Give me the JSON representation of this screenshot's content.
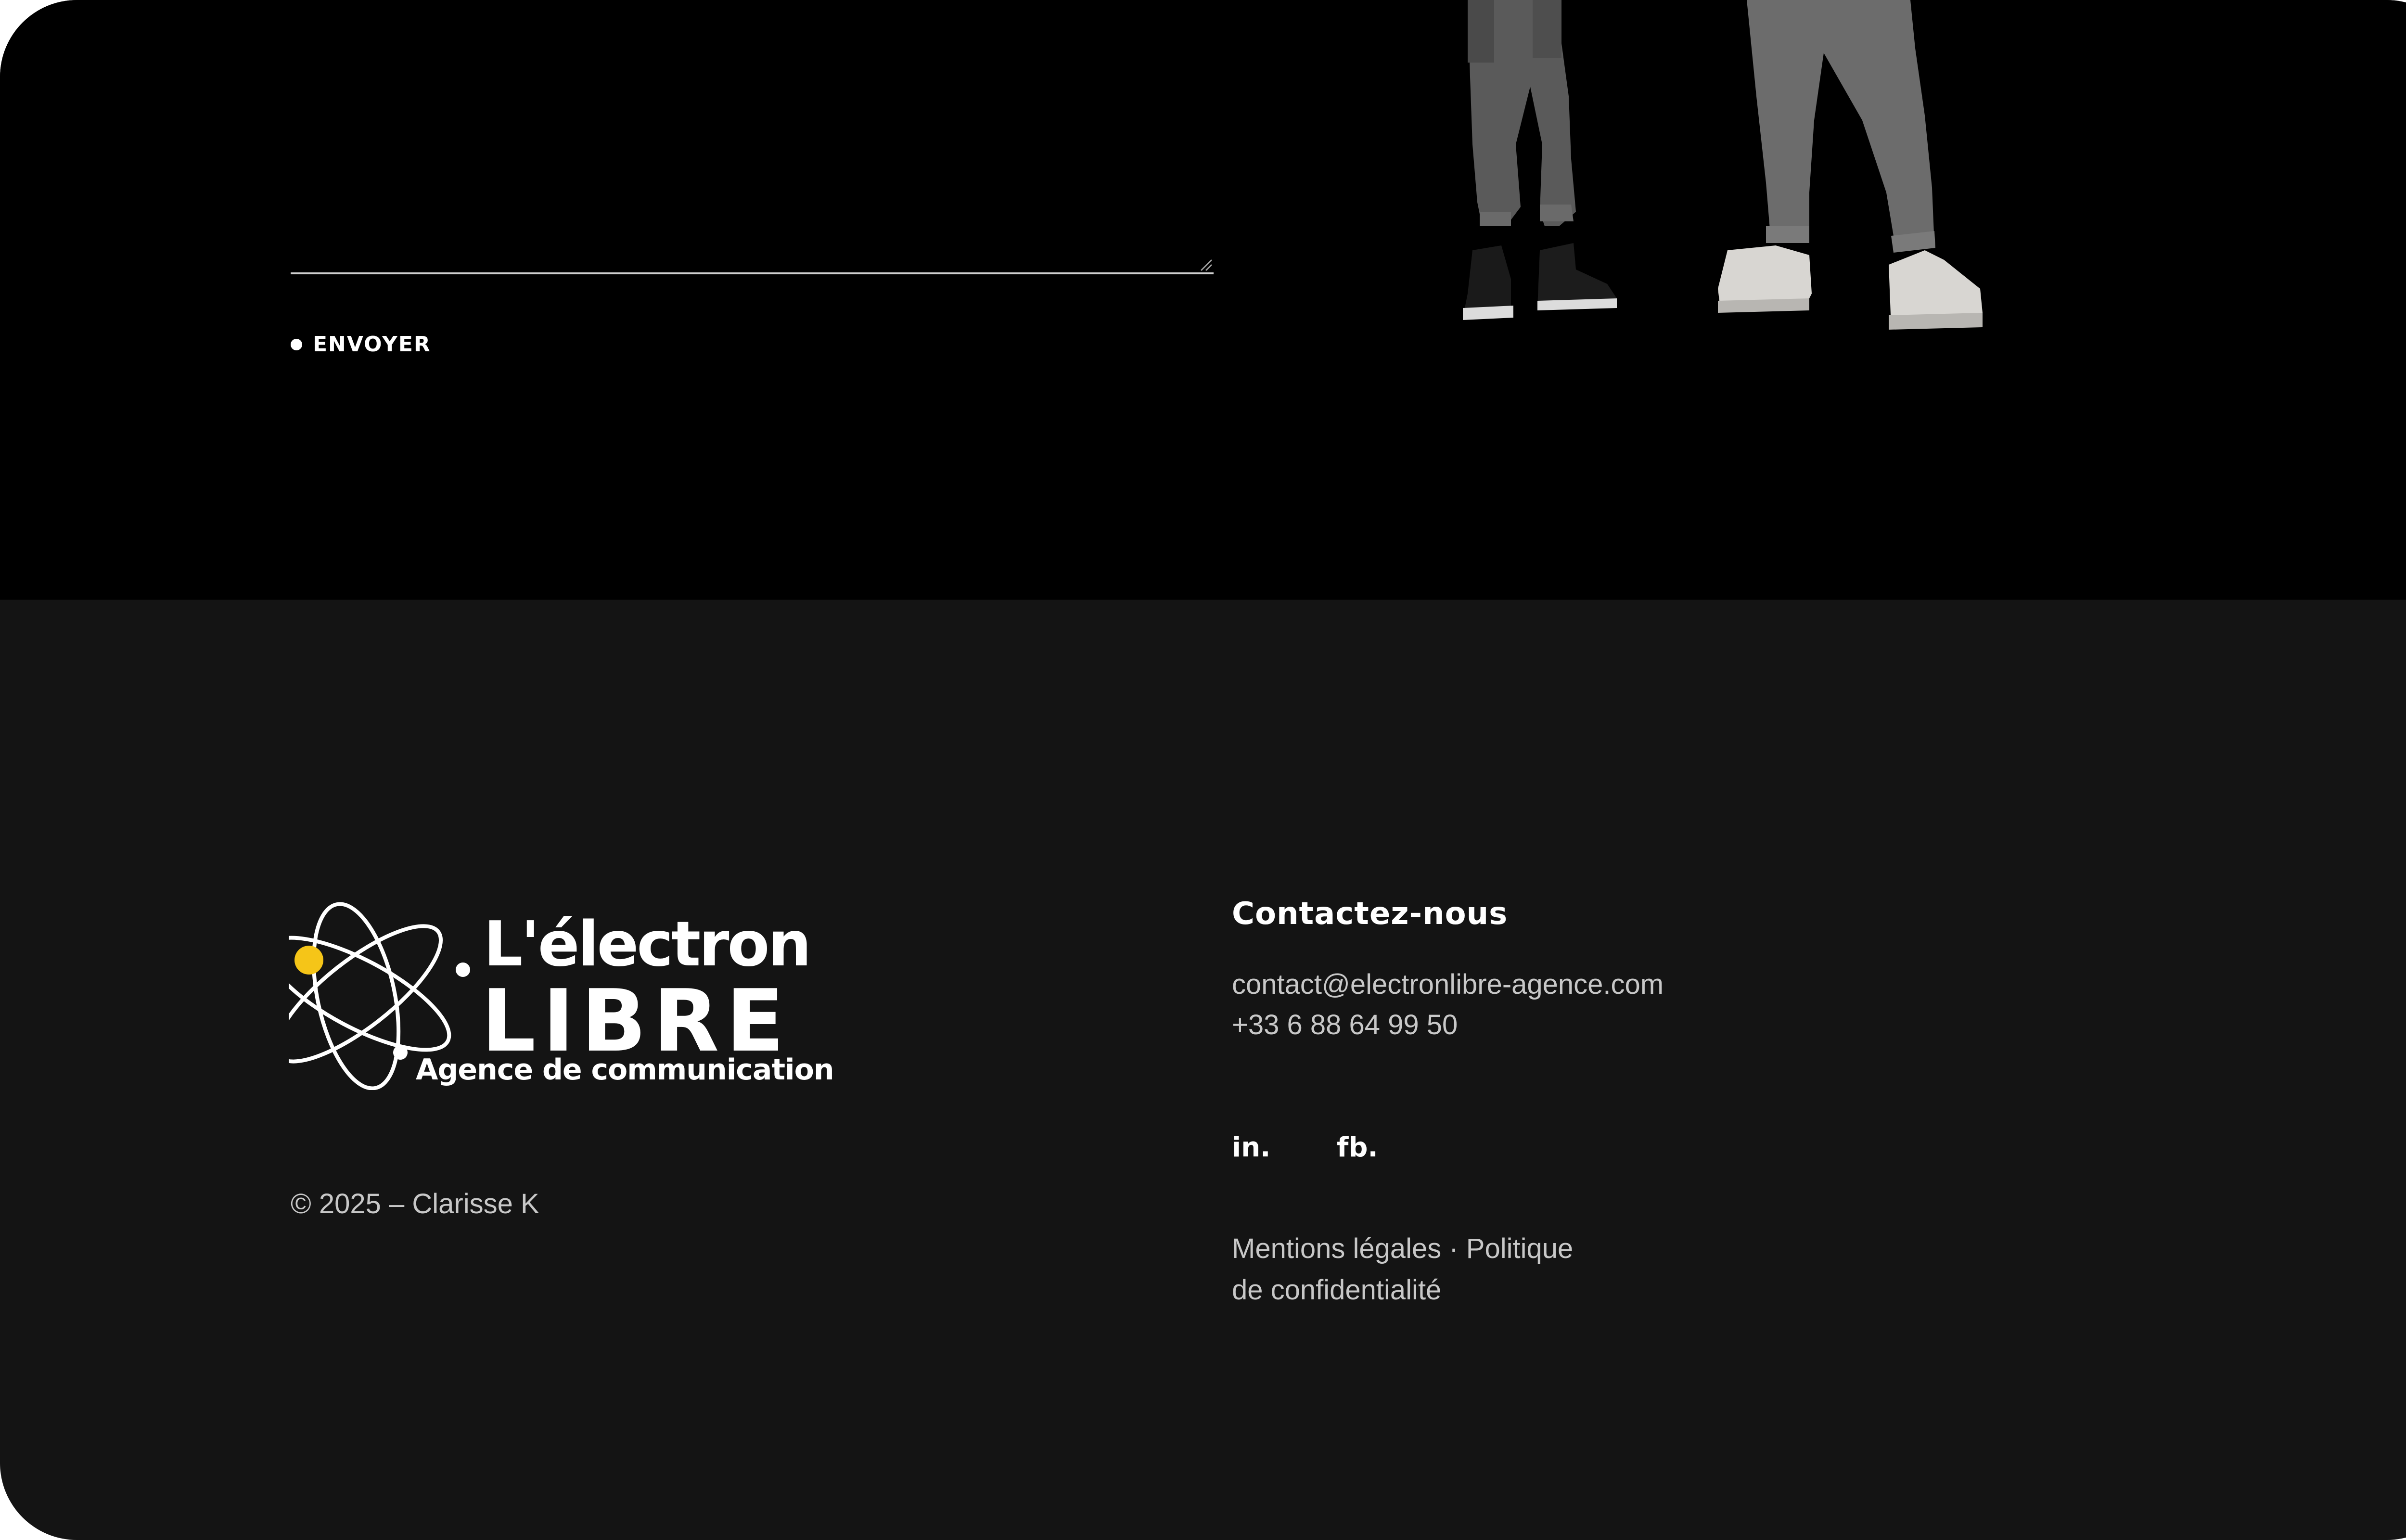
{
  "form": {
    "send_label": "ENVOYER"
  },
  "footer": {
    "logo": {
      "line1": "L'électron",
      "line2": "LIBRE",
      "line3": "Agence de communication",
      "accent_color": "#f5c518"
    },
    "copyright": "© 2025 – Clarisse K",
    "contact": {
      "heading": "Contactez-nous",
      "email": "contact@electronlibre-agence.com",
      "phone": "+33 6 88 64 99 50"
    },
    "social": {
      "linkedin": "in.",
      "facebook": "fb."
    },
    "legal": "Mentions légales · Politique de confidentialité"
  },
  "colors": {
    "top_background": "#000000",
    "footer_background": "#141414",
    "text_muted": "#c8c8c8",
    "text_strong": "#ffffff"
  }
}
